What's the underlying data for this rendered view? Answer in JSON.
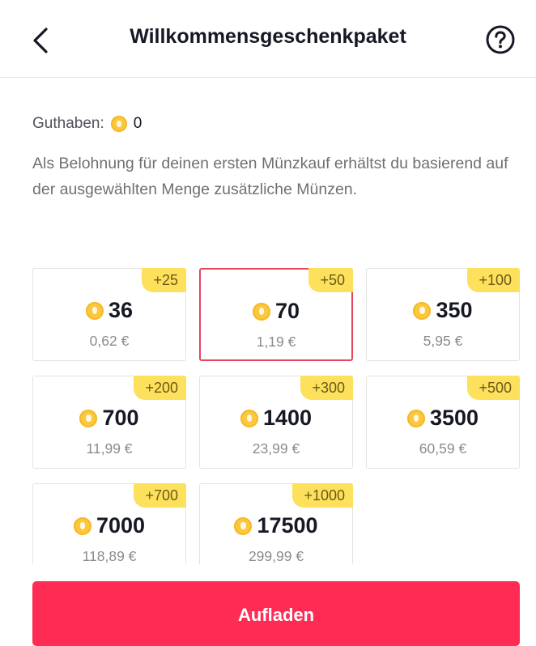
{
  "header": {
    "title": "Willkommensgeschenkpaket",
    "back_icon": "chevron-left-icon",
    "help_icon": "question-circle-icon"
  },
  "balance": {
    "label": "Guthaben:",
    "value": "0"
  },
  "description": "Als Belohnung für deinen ersten Münzkauf erhältst du basierend auf der ausgewählten Menge zusätzliche Münzen.",
  "packages": [
    {
      "bonus": "+25",
      "amount": "36",
      "price": "0,62 €",
      "selected": false
    },
    {
      "bonus": "+50",
      "amount": "70",
      "price": "1,19 €",
      "selected": true
    },
    {
      "bonus": "+100",
      "amount": "350",
      "price": "5,95 €",
      "selected": false
    },
    {
      "bonus": "+200",
      "amount": "700",
      "price": "11,99 €",
      "selected": false
    },
    {
      "bonus": "+300",
      "amount": "1400",
      "price": "23,99 €",
      "selected": false
    },
    {
      "bonus": "+500",
      "amount": "3500",
      "price": "60,59 €",
      "selected": false
    },
    {
      "bonus": "+700",
      "amount": "7000",
      "price": "118,89 €",
      "selected": false
    },
    {
      "bonus": "+1000",
      "amount": "17500",
      "price": "299,99 €",
      "selected": false
    }
  ],
  "recharge_button": {
    "label": "Aufladen"
  },
  "colors": {
    "accent": "#fe2c55",
    "selected_border": "#e3465c",
    "bonus_badge": "#fde05c",
    "coin": "#fcc83b"
  }
}
